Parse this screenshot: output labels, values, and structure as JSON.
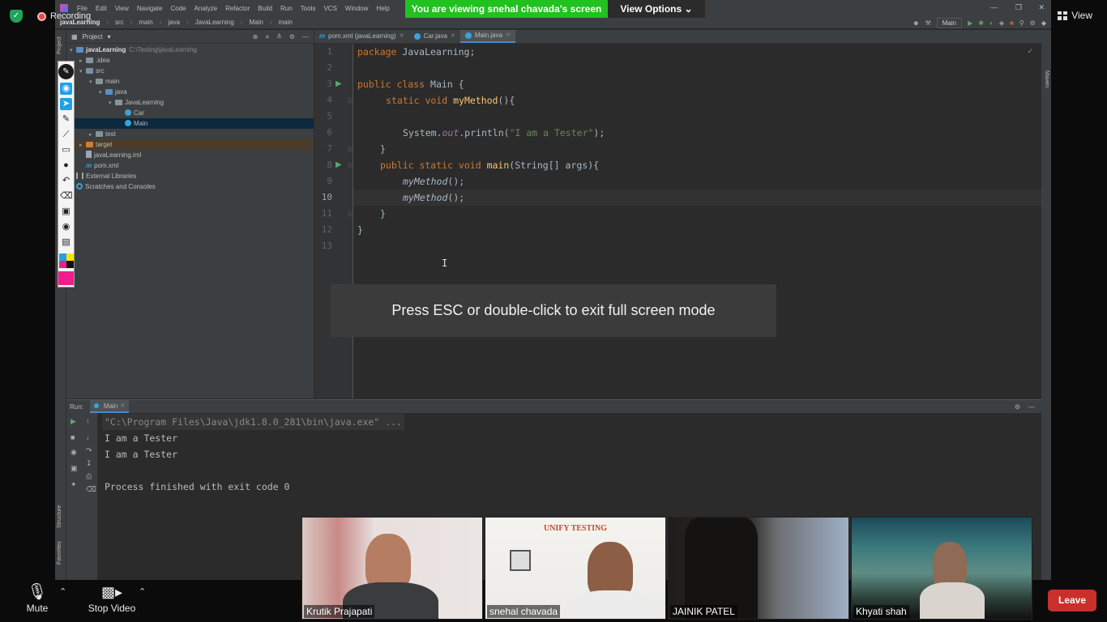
{
  "zoom": {
    "recording_label": "Recording",
    "view_label": "View",
    "share_banner": "You are viewing snehal chavada's screen",
    "view_options_label": "View Options",
    "fullscreen_toast": "Press ESC or double-click to exit full screen mode",
    "controls": {
      "mute": "Mute",
      "stop_video": "Stop Video",
      "leave": "Leave"
    },
    "participants": [
      "Krutik Prajapati",
      "snehal chavada",
      "JAINIK PATEL",
      "Khyati shah"
    ],
    "tile_brand": "UNIFY TESTING",
    "colors": {
      "banner": "#21c11f",
      "leave": "#c9302c",
      "shield": "#1fa55a"
    }
  },
  "ide": {
    "menu": [
      "File",
      "Edit",
      "View",
      "Navigate",
      "Code",
      "Analyze",
      "Refactor",
      "Build",
      "Run",
      "Tools",
      "VCS",
      "Window",
      "Help"
    ],
    "window_title": "javaLearnin",
    "run_config": "Main",
    "breadcrumbs": [
      "javaLearning",
      "src",
      "main",
      "java",
      "JavaLearning",
      "Main",
      "main"
    ],
    "project_label": "Project",
    "strip_labels": {
      "project": "Project",
      "structure": "Structure",
      "favorites": "Favorites",
      "maven": "Maven"
    },
    "tree": {
      "root_name": "javaLearning",
      "root_path": "C:\\Testing\\javaLearning",
      "idea": ".idea",
      "src": "src",
      "main": "main",
      "java": "java",
      "pkg": "JavaLearning",
      "car": "Car",
      "mainclass": "Main",
      "test": "test",
      "target": "target",
      "iml": "javaLearning.iml",
      "pom": "pom.xml",
      "libs": "External Libraries",
      "scratches": "Scratches and Consoles"
    },
    "tabs": [
      {
        "icon": "m",
        "label": "pom.xml (javaLearning)"
      },
      {
        "icon": "c",
        "label": "Car.java"
      },
      {
        "icon": "c",
        "label": "Main.java"
      }
    ],
    "line_numbers": [
      "1",
      "2",
      "3",
      "4",
      "5",
      "6",
      "7",
      "8",
      "9",
      "10",
      "11",
      "12",
      "13"
    ],
    "code": {
      "l1_kw": "package ",
      "l1_rest": "JavaLearning;",
      "l3_kw": "public class ",
      "l3_rest": "Main {",
      "l4_kw": "static void ",
      "l4_fn": "myMethod",
      "l4_rest": "(){",
      "l6_a": "System.",
      "l6_out": "out",
      "l6_b": ".println(",
      "l6_str": "\"I am a Tester\"",
      "l6_c": ");",
      "l7": "}",
      "l8_kw": "public static void ",
      "l8_fn": "main",
      "l8_rest": "(String[] args){",
      "l9": "myMethod",
      "l9_rest": "();",
      "l10": "myMethod",
      "l10_rest": "();",
      "l11": "}",
      "l12": "}"
    },
    "run": {
      "label": "Run:",
      "tab": "Main",
      "lines": [
        "\"C:\\Program Files\\Java\\jdk1.8.0_281\\bin\\java.exe\" ...",
        "I am a Tester",
        "I am a Tester",
        "Process finished with exit code 0"
      ]
    }
  }
}
